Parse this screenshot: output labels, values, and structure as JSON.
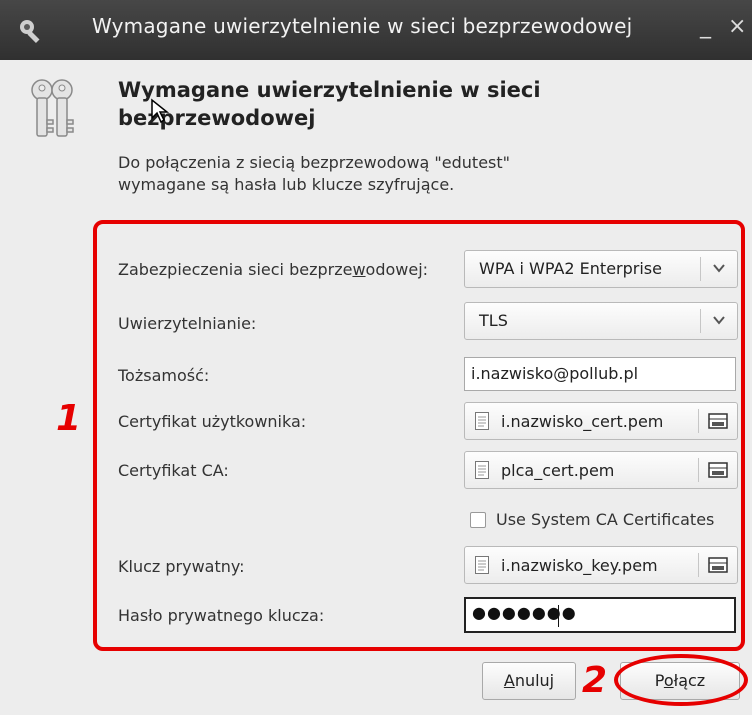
{
  "window": {
    "title": "Wymagane uwierzytelnienie w sieci bezprzewodowej",
    "minimize": "_",
    "close": "×"
  },
  "dialog": {
    "heading_line1": "Wymagane uwierzytelnienie w sieci",
    "heading_line2": "bezprzewodowej",
    "desc_line1": "Do połączenia z siecią bezprzewodową \"edutest\"",
    "desc_line2": "wymagane są hasła lub klucze szyfrujące."
  },
  "form": {
    "security_label_pre": "Zabezpieczenia sieci bezprze",
    "security_label_u": "w",
    "security_label_post": "odowej:",
    "security_value": "WPA i WPA2 Enterprise",
    "auth_label": "Uwierzytelnianie:",
    "auth_value": "TLS",
    "identity_label": "Tożsamość:",
    "identity_value": "i.nazwisko@pollub.pl",
    "user_cert_label": "Certyfikat użytkownika:",
    "user_cert_value": "i.nazwisko_cert.pem",
    "ca_cert_label": "Certyfikat CA:",
    "ca_cert_value": "plca_cert.pem",
    "use_system_ca_label": "Use System CA Certificates",
    "private_key_label": "Klucz prywatny:",
    "private_key_value": "i.nazwisko_key.pem",
    "private_key_pwd_label": "Hasło prywatnego klucza:",
    "private_key_pwd_value": "●●●●●●●"
  },
  "buttons": {
    "cancel_u": "A",
    "cancel_rest": "nuluj",
    "connect_pre": "P",
    "connect_u": "o",
    "connect_post": "łącz"
  },
  "annotations": {
    "one": "1",
    "two": "2"
  },
  "colors": {
    "annotation": "#e60000",
    "titlebar": "#3a3a3a",
    "dialog_bg": "#ededed"
  }
}
